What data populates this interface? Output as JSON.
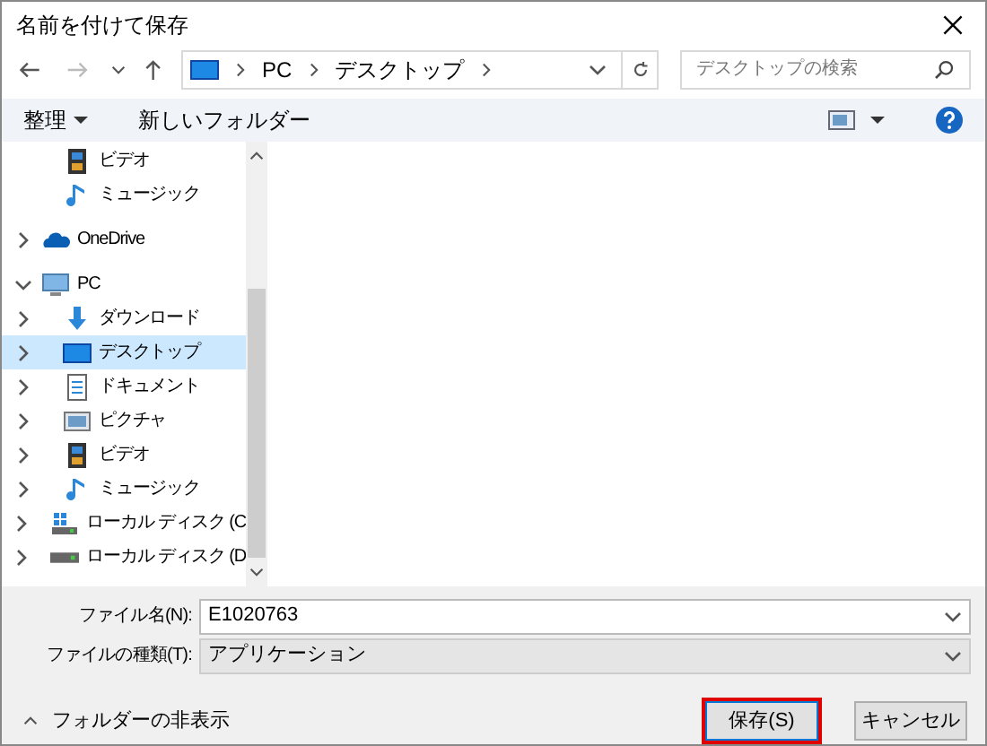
{
  "window": {
    "title": "名前を付けて保存"
  },
  "address": {
    "path": [
      "PC",
      "デスクトップ"
    ],
    "search_placeholder": "デスクトップの検索"
  },
  "toolbar": {
    "organize": "整理",
    "new_folder": "新しいフォルダー"
  },
  "tree_continued": [
    {
      "label": "ビデオ",
      "kind": "video",
      "selected": false
    },
    {
      "label": "ミュージック",
      "kind": "music",
      "selected": false
    }
  ],
  "tree": [
    {
      "label": "OneDrive",
      "kind": "cloud",
      "selected": false,
      "expanded": false
    },
    {
      "label": "PC",
      "kind": "pc",
      "selected": false,
      "expanded": true,
      "children": [
        {
          "label": "ダウンロード",
          "kind": "download",
          "selected": false,
          "expanded": false
        },
        {
          "label": "デスクトップ",
          "kind": "desktop",
          "selected": true,
          "expanded": false
        },
        {
          "label": "ドキュメント",
          "kind": "document",
          "selected": false,
          "expanded": false
        },
        {
          "label": "ピクチャ",
          "kind": "picture",
          "selected": false,
          "expanded": false
        },
        {
          "label": "ビデオ",
          "kind": "video",
          "selected": false,
          "expanded": false
        },
        {
          "label": "ミュージック",
          "kind": "music",
          "selected": false,
          "expanded": false
        },
        {
          "label": "ローカル ディスク (C",
          "kind": "drive-c",
          "selected": false,
          "expanded": false
        },
        {
          "label": "ローカル ディスク (D",
          "kind": "drive",
          "selected": false,
          "expanded": false
        }
      ]
    }
  ],
  "file_name": {
    "label": "ファイル名(N):",
    "value": "E1020763"
  },
  "file_type": {
    "label": "ファイルの種類(T):",
    "value": "アプリケーション"
  },
  "hide_folders": "フォルダーの非表示",
  "buttons": [
    {
      "label": "保存(S)",
      "kind": "primary",
      "highlighted": true
    },
    {
      "label": "キャンセル",
      "kind": "secondary",
      "highlighted": false
    }
  ]
}
